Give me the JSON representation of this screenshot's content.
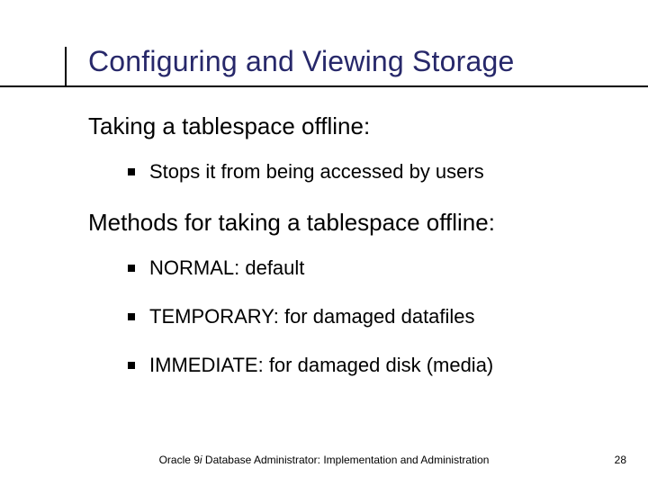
{
  "title": "Configuring and Viewing Storage",
  "sections": [
    {
      "heading": "Taking a tablespace offline:",
      "bullets": [
        "Stops it from being accessed by users"
      ]
    },
    {
      "heading": "Methods for taking a tablespace offline:",
      "bullets": [
        "NORMAL: default",
        "TEMPORARY: for damaged datafiles",
        "IMMEDIATE: for damaged disk (media)"
      ]
    }
  ],
  "footer": {
    "prefix": "Oracle 9",
    "italic": "i",
    "suffix": " Database Administrator: Implementation and Administration"
  },
  "page_number": "28"
}
